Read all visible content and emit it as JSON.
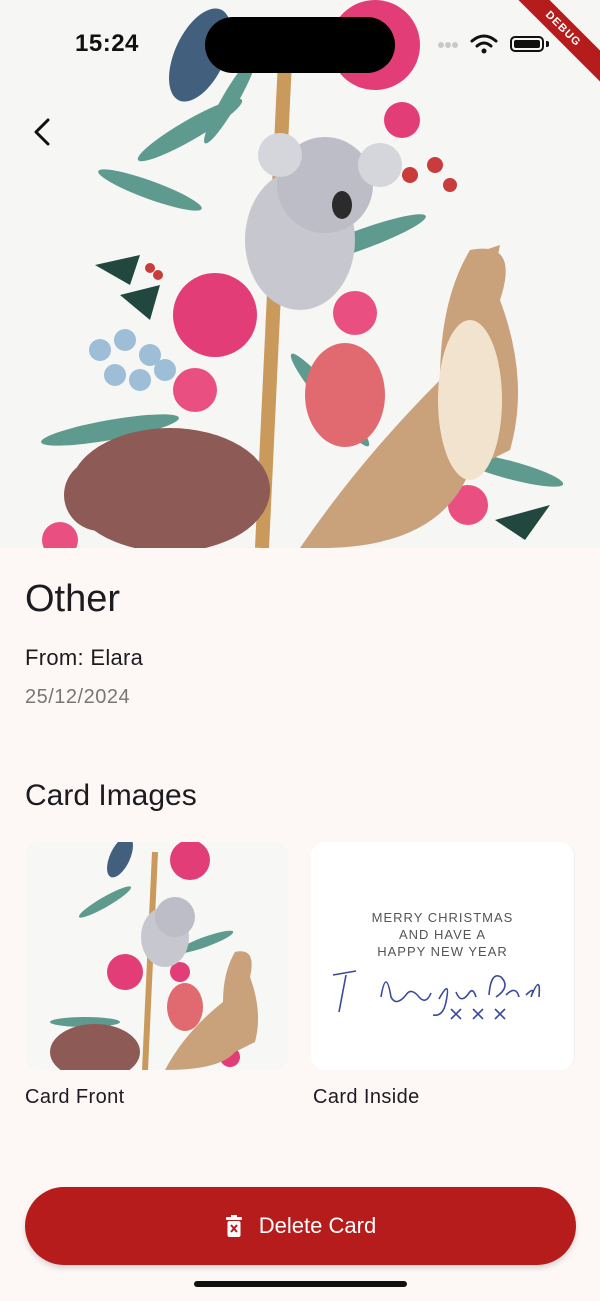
{
  "status_bar": {
    "time": "15:24"
  },
  "debug_banner": "DEBUG",
  "card": {
    "title": "Other",
    "from": "From: Elara",
    "date": "25/12/2024"
  },
  "images_section": {
    "heading": "Card Images",
    "items": [
      {
        "label": "Card Front"
      },
      {
        "label": "Card Inside",
        "printed_text": [
          "MERRY CHRISTMAS",
          "AND HAVE A",
          "HAPPY NEW YEAR"
        ],
        "handwriting": "I love you Dad xxx"
      }
    ]
  },
  "actions": {
    "delete_label": "Delete Card"
  },
  "icons": {
    "back": "chevron-left-icon",
    "delete": "trash-icon"
  },
  "colors": {
    "accent": "#b71c1c",
    "background": "#fdf8f6"
  }
}
